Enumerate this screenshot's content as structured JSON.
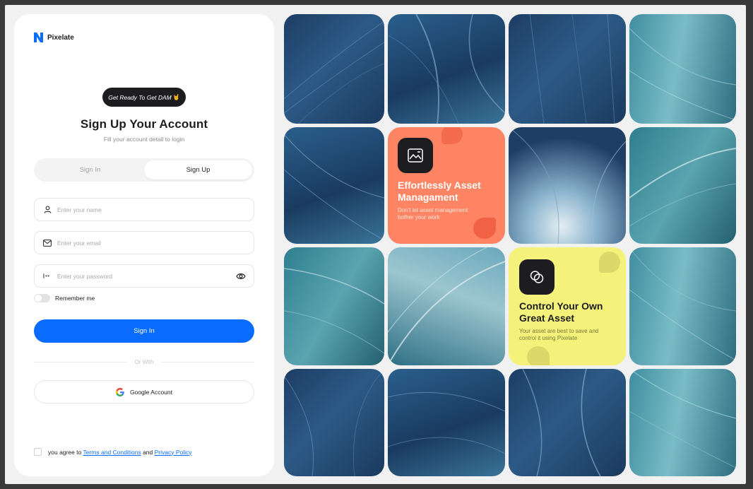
{
  "brand": {
    "name": "Pixelate",
    "accent": "#0a6cff"
  },
  "pill": {
    "text": "Get Ready To Get DAM",
    "emoji": "🤘"
  },
  "heading": {
    "title": "Sign Up Your Account",
    "subtitle": "Fill your account detail to login"
  },
  "tabs": [
    {
      "label": "Sign In",
      "active": false
    },
    {
      "label": "Sign Up",
      "active": true
    }
  ],
  "form": {
    "name": {
      "placeholder": "Enter your name",
      "value": "",
      "icon": "user-icon"
    },
    "email": {
      "placeholder": "Enter your email",
      "value": "",
      "icon": "mail-icon"
    },
    "password": {
      "placeholder": "Enter your password",
      "value": "",
      "icon": "password-icon",
      "toggle_icon": "eye-icon"
    },
    "remember_label": "Remember me",
    "remember_checked": false,
    "submit_label": "Sign In",
    "divider_label": "Or With",
    "google_label": "Google Account"
  },
  "agreement": {
    "prefix": "you agree to",
    "terms": "Terms and Conditions",
    "and": "and",
    "privacy": "Privacy Policy",
    "checked": false
  },
  "cards": {
    "orange": {
      "title": "Effortlessly Asset Managament",
      "description": "Don't let asset management bother your work",
      "color": "#ff8463",
      "icon": "image-edit-icon"
    },
    "yellow": {
      "title": "Control Your Own Great Asset",
      "description": "Your asset are best to save and control it using Pixelate",
      "color": "#f4f27a",
      "icon": "overlap-circles-icon"
    }
  }
}
